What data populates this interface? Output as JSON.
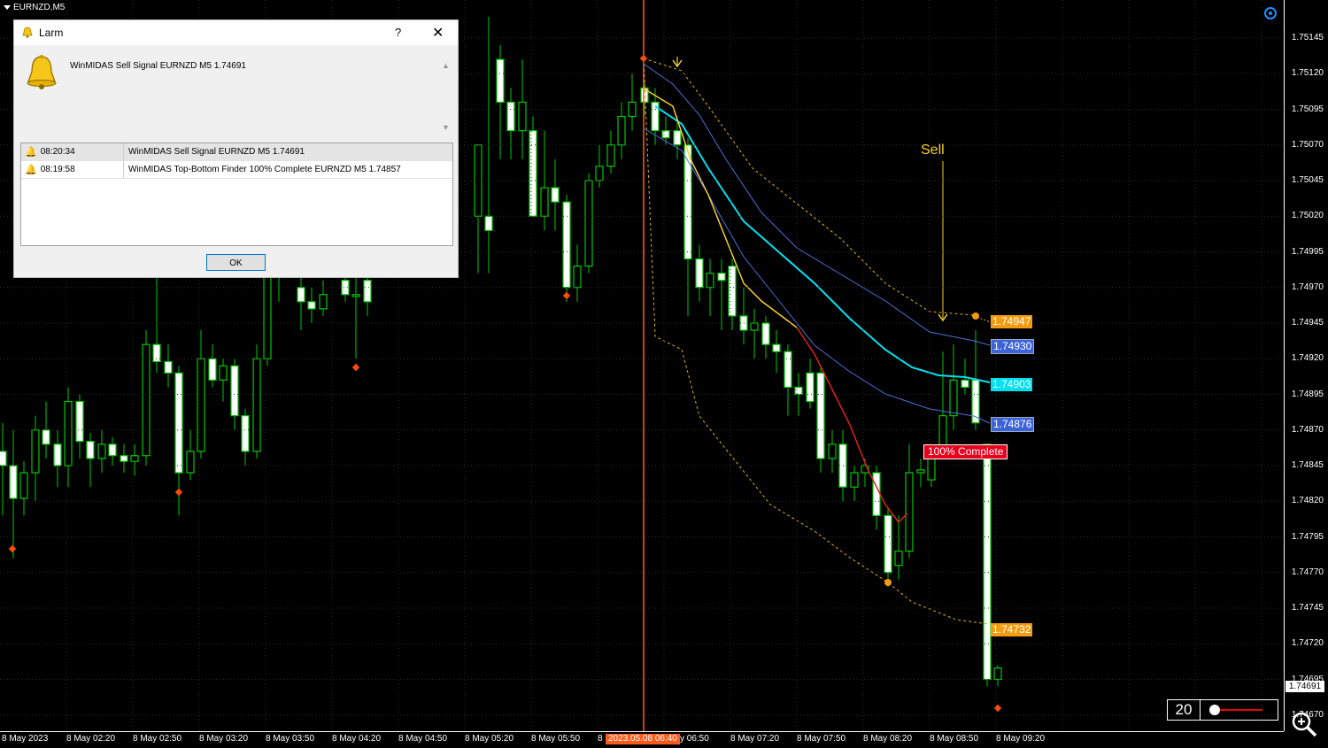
{
  "window": {
    "symbol": "EURNZD,M5"
  },
  "price_scale": {
    "labels": [
      "1.75145",
      "1.75120",
      "1.75095",
      "1.75070",
      "1.75045",
      "1.75020",
      "1.74995",
      "1.74970",
      "1.74945",
      "1.74920",
      "1.74895",
      "1.74870",
      "1.74845",
      "1.74820",
      "1.74795",
      "1.74770",
      "1.74745",
      "1.74720",
      "1.74695",
      "1.74670"
    ]
  },
  "time_axis": {
    "labels": [
      "8 May 2023",
      "8 May 02:20",
      "8 May 02:50",
      "8 May 03:20",
      "8 May 03:50",
      "8 May 04:20",
      "8 May 04:50",
      "8 May 05:20",
      "8 May 05:50",
      "8",
      "y 06:50",
      "8 May 07:20",
      "8 May 07:50",
      "8 May 08:20",
      "8 May 08:50",
      "8 May 09:20"
    ],
    "cursor_date": "2023.05.08 06:40"
  },
  "indicator": {
    "sell_label": "Sell",
    "complete_label": "100% Complete",
    "price_tags": [
      "1.74947",
      "1.74930",
      "1.74903",
      "1.74876",
      "1.74732"
    ],
    "current_price": "1.74691"
  },
  "controls": {
    "period_value": "20"
  },
  "colors": {
    "bull": "#00d000",
    "bear": "#ffffff",
    "accent": "#1e90ff",
    "cursor": "#ff5a1a",
    "sell": "#f5d030"
  },
  "dialog": {
    "title": "Larm",
    "help": "?",
    "message": "WinMIDAS Sell Signal EURNZD M5 1.74691",
    "alerts": [
      {
        "time": "08:20:34",
        "text": "WinMIDAS Sell Signal EURNZD M5 1.74691"
      },
      {
        "time": "08:19:58",
        "text": "WinMIDAS Top-Bottom Finder 100% Complete EURNZD M5 1.74857"
      }
    ],
    "ok_label": "OK"
  }
}
